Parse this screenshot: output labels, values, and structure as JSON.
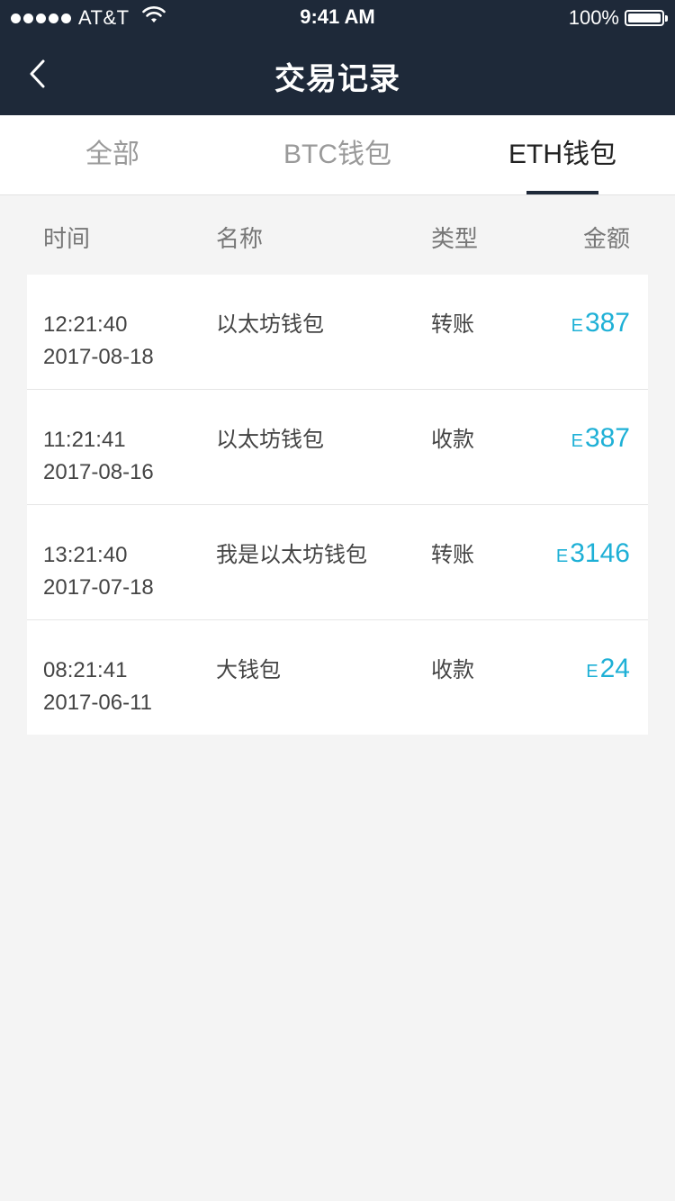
{
  "status_bar": {
    "carrier": "AT&T",
    "time": "9:41 AM",
    "battery": "100%"
  },
  "nav": {
    "title": "交易记录",
    "back_icon": "chevron-left-icon"
  },
  "tabs": [
    {
      "label": "全部",
      "active": false
    },
    {
      "label": "BTC钱包",
      "active": false
    },
    {
      "label": "ETH钱包",
      "active": true
    }
  ],
  "columns": {
    "time": "时间",
    "name": "名称",
    "type": "类型",
    "amount": "金额"
  },
  "currency_symbol": "E",
  "transactions": [
    {
      "time": "12:21:40",
      "date": "2017-08-18",
      "name": "以太坊钱包",
      "type": "转账",
      "amount": "387"
    },
    {
      "time": "11:21:41",
      "date": "2017-08-16",
      "name": "以太坊钱包",
      "type": "收款",
      "amount": "387"
    },
    {
      "time": "13:21:40",
      "date": "2017-07-18",
      "name": "我是以太坊钱包",
      "type": "转账",
      "amount": "3146"
    },
    {
      "time": "08:21:41",
      "date": "2017-06-11",
      "name": "大钱包",
      "type": "收款",
      "amount": "24"
    }
  ],
  "colors": {
    "header_bg": "#1e2939",
    "amount": "#1eb0d6",
    "page_bg": "#f4f4f4"
  }
}
